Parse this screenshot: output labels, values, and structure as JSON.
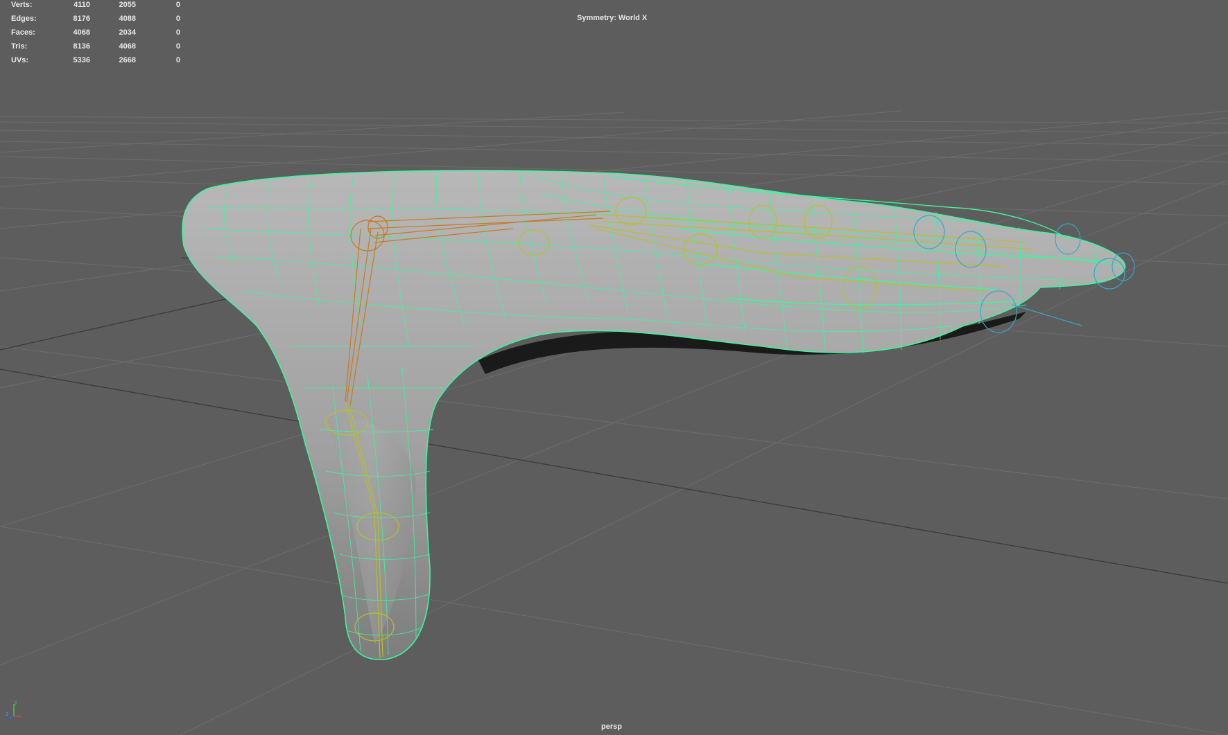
{
  "hud": {
    "rows": [
      {
        "label": "Verts:",
        "v1": "4110",
        "v2": "2055",
        "v3": "0"
      },
      {
        "label": "Edges:",
        "v1": "8176",
        "v2": "4088",
        "v3": "0"
      },
      {
        "label": "Faces:",
        "v1": "4068",
        "v2": "2034",
        "v3": "0"
      },
      {
        "label": "Tris:",
        "v1": "8136",
        "v2": "4068",
        "v3": "0"
      },
      {
        "label": "UVs:",
        "v1": "5336",
        "v2": "2668",
        "v3": "0"
      }
    ]
  },
  "symmetry": "Symmetry: World X",
  "camera": "persp",
  "gizmo": {
    "y": "y",
    "z": "z"
  },
  "colors": {
    "background": "#5d5d5d",
    "grid": "#6e6e6e",
    "wireframe": "#3cf5a0",
    "joints": "#c87a1e",
    "joints_alt": "#b8c02a",
    "controls": "#3aa6c8"
  }
}
